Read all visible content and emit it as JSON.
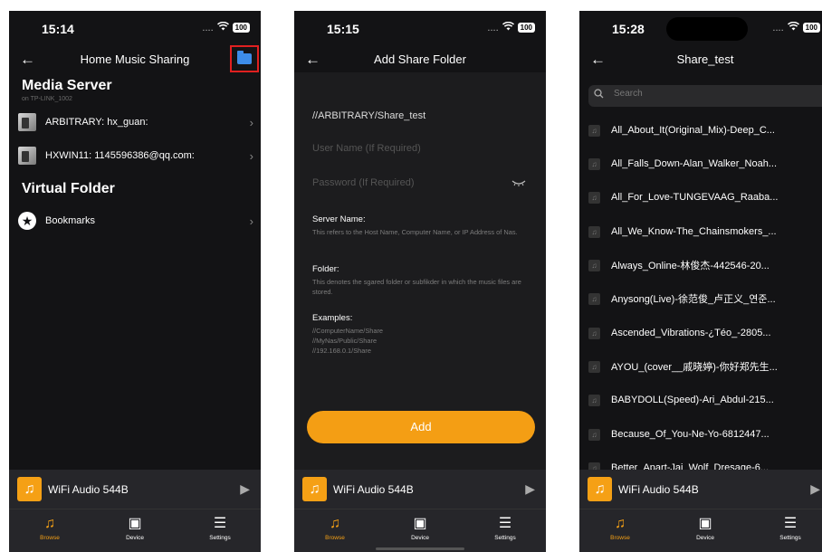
{
  "screen1": {
    "status": {
      "time": "15:14",
      "signal": "....",
      "battery": "100"
    },
    "header": {
      "title": "Home Music Sharing"
    },
    "media_server": {
      "title": "Media Server",
      "subtitle": "on TP-LINK_1002",
      "items": [
        {
          "label": "ARBITRARY: hx_guan:"
        },
        {
          "label": "HXWIN11: 1145596386@qq.com:"
        }
      ]
    },
    "virtual_folder": {
      "title": "Virtual Folder",
      "items": [
        {
          "label": "Bookmarks"
        }
      ]
    }
  },
  "screen2": {
    "status": {
      "time": "15:15",
      "signal": "....",
      "battery": "100"
    },
    "header": {
      "title": "Add Share Folder"
    },
    "form": {
      "path_value": "//ARBITRARY/Share_test",
      "username_placeholder": "User Name (If Required)",
      "password_placeholder": "Password (If Required)"
    },
    "help": {
      "server_label": "Server Name:",
      "server_desc": "This refers to the Host Name, Computer Name, or IP Address of Nas.",
      "folder_label": "Folder:",
      "folder_desc": "This denotes the sgared folder or subfikder in which the music files are stored.",
      "examples_label": "Examples:",
      "examples": [
        "//ComputerName/Share",
        "//MyNas/Public/Share",
        "//192.168.0.1/Share"
      ]
    },
    "add_label": "Add"
  },
  "screen3": {
    "status": {
      "time": "15:28",
      "signal": "....",
      "battery": "100"
    },
    "header": {
      "title": "Share_test"
    },
    "search_placeholder": "Search",
    "songs": [
      "All_About_It(Original_Mix)-Deep_C...",
      "All_Falls_Down-Alan_Walker_Noah...",
      "All_For_Love-TUNGEVAAG_Raaba...",
      "All_We_Know-The_Chainsmokers_...",
      "Always_Online-林俊杰-442546-20...",
      "Anysong(Live)-徐范俊_卢正义_연준...",
      "Ascended_Vibrations-¿Téo_-2805...",
      "AYOU_(cover__戚晓婷)-你好郑先生...",
      "BABYDOLL(Speed)-Ari_Abdul-215...",
      "Because_Of_You-Ne-Yo-6812447...",
      "Better_Apart-Jai_Wolf_Dresage-6..."
    ]
  },
  "player": {
    "device_name": "WiFi Audio 544B"
  },
  "tabs": [
    {
      "label": "Browse",
      "icon": "music-note-icon"
    },
    {
      "label": "Device",
      "icon": "speaker-icon"
    },
    {
      "label": "Settings",
      "icon": "sliders-icon"
    }
  ],
  "colors": {
    "accent": "#f5a015",
    "highlight_box": "#e02020",
    "folder_icon": "#3d8ce8"
  }
}
